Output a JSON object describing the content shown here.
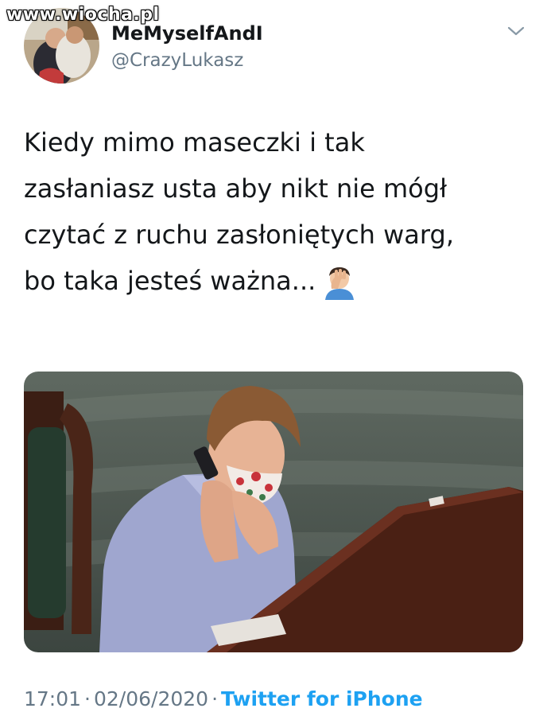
{
  "watermark": "www.wiocha.pl",
  "author": {
    "display_name": "MeMyselfAndI",
    "handle": "@CrazyLukasz"
  },
  "tweet": {
    "lines": [
      "Kiedy mimo maseczki i tak",
      "zasłaniasz usta aby nikt nie mógł",
      "czytać z ruchu zasłoniętych warg,",
      "bo taka jesteś ważna..."
    ],
    "emoji": "facepalm-icon"
  },
  "meta": {
    "time": "17:01",
    "separator": "·",
    "date": "02/06/2020",
    "source": "Twitter for iPhone"
  },
  "colors": {
    "text": "#14171a",
    "secondary": "#657786",
    "link": "#1da1f2"
  }
}
